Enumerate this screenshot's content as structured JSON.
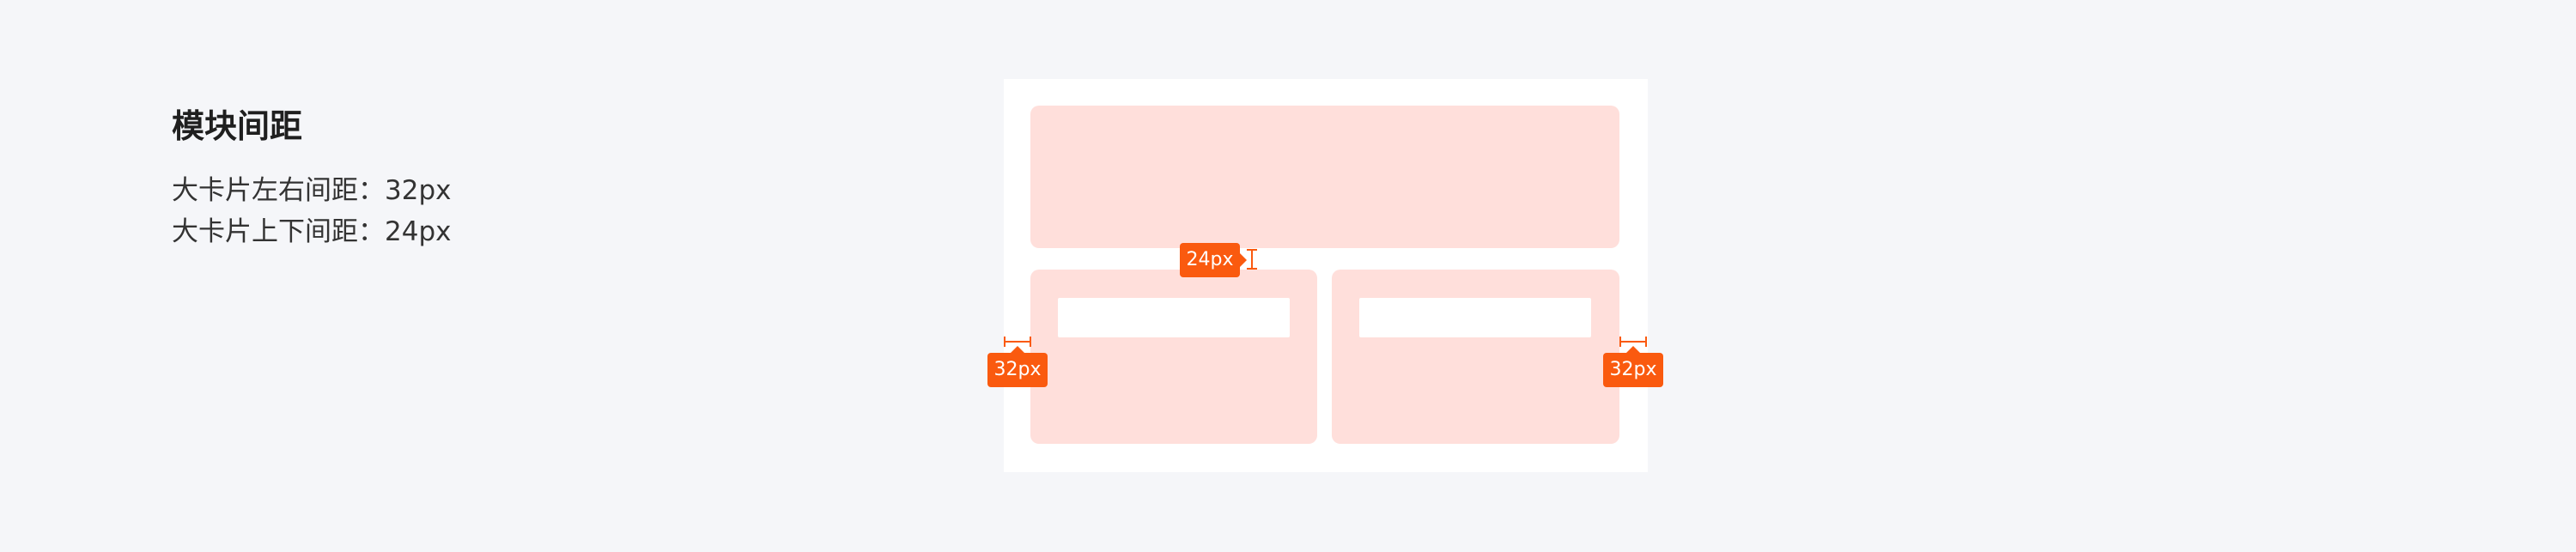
{
  "heading": "模块间距",
  "specs": [
    "大卡片左右间距：32px",
    "大卡片上下间距：24px"
  ],
  "annotations": {
    "vertical_gap": "24px",
    "left_margin": "32px",
    "right_margin": "32px"
  },
  "colors": {
    "page_background": "#f5f6f9",
    "frame_background": "#ffffff",
    "card_fill": "#ffdfdb",
    "annotation_accent": "#fa5a0f"
  }
}
